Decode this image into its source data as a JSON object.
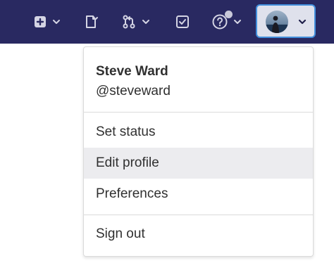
{
  "colors": {
    "topbar_bg": "#292961",
    "icon_fg": "#d4d4e4",
    "focus_ring": "#428fdc",
    "menu_hover_bg": "#ececef",
    "text": "#303030"
  },
  "topbar": {
    "icons": [
      "plus-square-icon",
      "chevron-down-icon",
      "snippet-icon",
      "merge-request-icon",
      "chevron-down-icon",
      "todo-checkbox-icon",
      "help-question-icon",
      "notification-dot",
      "chevron-down-icon"
    ]
  },
  "user_menu": {
    "avatar_icon": "user-avatar",
    "name": "Steve Ward",
    "username": "@steveward",
    "items": [
      {
        "label": "Set status"
      },
      {
        "label": "Edit profile",
        "highlighted": true
      },
      {
        "label": "Preferences"
      }
    ],
    "sign_out_label": "Sign out"
  }
}
